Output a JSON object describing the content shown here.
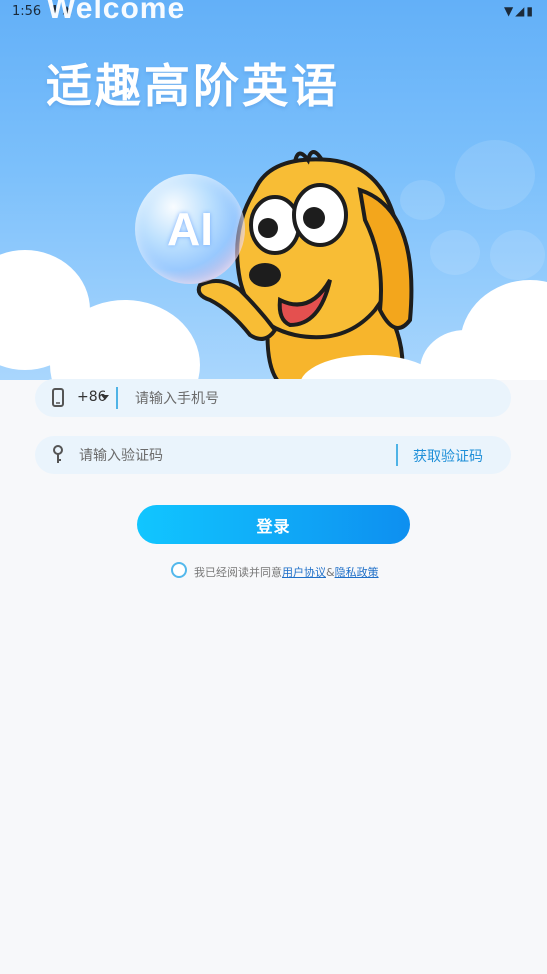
{
  "status_bar": {
    "time": "1:56",
    "left_icons": "⬇ ▲",
    "right_icons": "▼◢▮"
  },
  "hero": {
    "welcome": "Welcome",
    "title": "适趣高阶英语",
    "bubble_text": "AI"
  },
  "phone_field": {
    "country_code": "+86",
    "placeholder": "请输入手机号",
    "value": ""
  },
  "code_field": {
    "placeholder": "请输入验证码",
    "value": "",
    "get_code_label": "获取验证码"
  },
  "login_button_label": "登录",
  "agreement": {
    "prefix": "我已经阅读并同意",
    "user_agreement": "用户协议",
    "separator": "&",
    "privacy_policy": "隐私政策",
    "checked": false
  },
  "colors": {
    "accent": "#0e8ff0",
    "accent_light": "#11c6ff",
    "field_bg": "#eaf4fc",
    "page_bg": "#f7f8fa",
    "hero_top": "#63b0f8"
  },
  "icons": {
    "phone": "phone-icon",
    "key": "key-icon",
    "caret": "chevron-down-icon",
    "radio": "radio-button"
  }
}
